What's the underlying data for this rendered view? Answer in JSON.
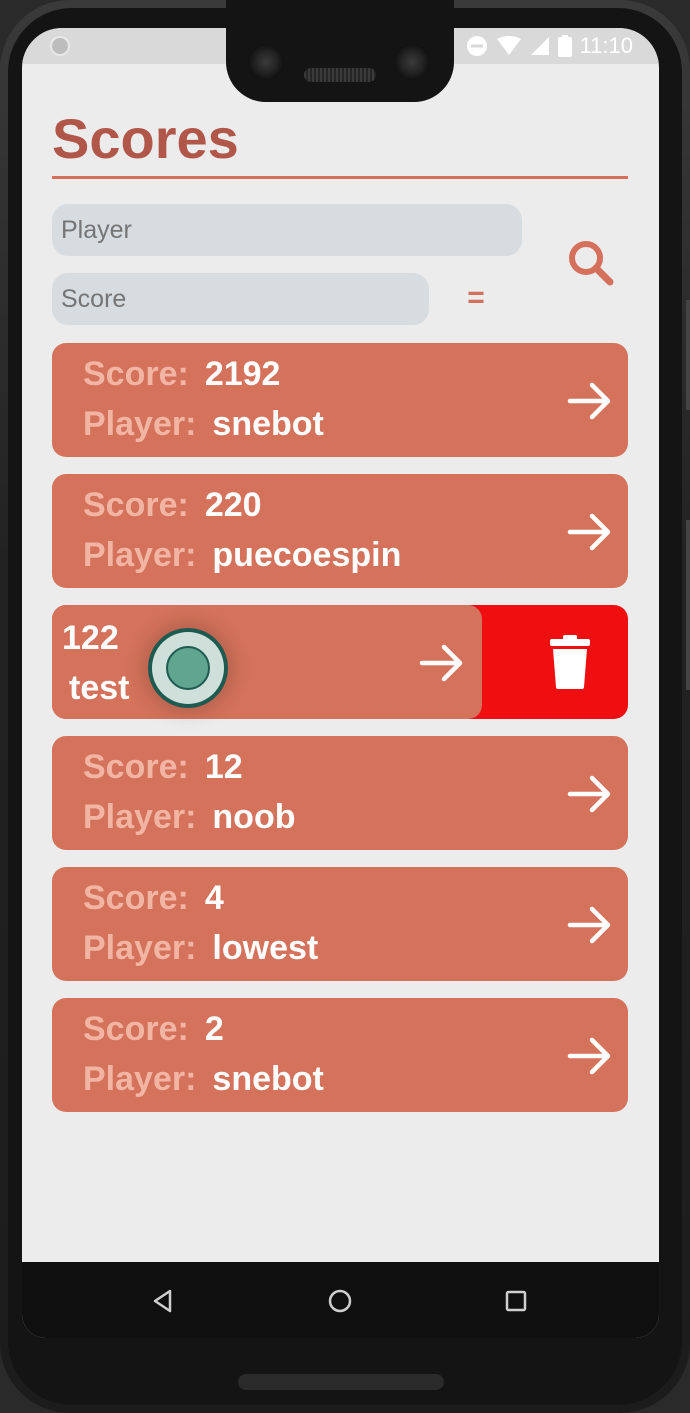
{
  "status_bar": {
    "time": "11:10"
  },
  "header": {
    "title": "Scores"
  },
  "filters": {
    "player_placeholder": "Player",
    "score_placeholder": "Score",
    "comparator": "="
  },
  "labels": {
    "score": "Score:",
    "player": "Player:"
  },
  "scores": [
    {
      "score": "2192",
      "player": "snebot"
    },
    {
      "score": "220",
      "player": "puecoespin"
    },
    {
      "score": "122",
      "player": "test",
      "swiped": true
    },
    {
      "score": "12",
      "player": "noob"
    },
    {
      "score": "4",
      "player": "lowest"
    },
    {
      "score": "2",
      "player": "snebot"
    }
  ],
  "colors": {
    "accent": "#d4725b",
    "title": "#b0574a",
    "delete": "#ef0f11",
    "background": "#ececec",
    "input": "#d6dce0"
  },
  "icons": {
    "search": "search-icon",
    "row_open": "arrow-right-icon",
    "delete": "trash-icon",
    "nav_back": "back-triangle-icon",
    "nav_home": "home-circle-icon",
    "nav_recents": "recents-square-icon"
  }
}
